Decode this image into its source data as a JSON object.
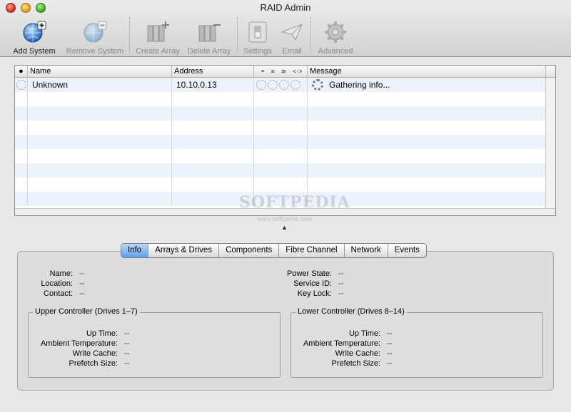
{
  "window": {
    "title": "RAID Admin"
  },
  "toolbar": {
    "items": [
      {
        "label": "Add System",
        "icon": "globe-plus-icon",
        "enabled": true
      },
      {
        "label": "Remove System",
        "icon": "globe-minus-icon",
        "enabled": false
      },
      {
        "label": "Create Array",
        "icon": "disks-plus-icon",
        "enabled": false
      },
      {
        "label": "Delete Array",
        "icon": "disks-minus-icon",
        "enabled": false
      },
      {
        "label": "Settings",
        "icon": "switch-icon",
        "enabled": false
      },
      {
        "label": "Email",
        "icon": "paper-plane-icon",
        "enabled": false
      },
      {
        "label": "Advanced",
        "icon": "gear-icon",
        "enabled": false
      }
    ]
  },
  "table": {
    "columns": {
      "name": "Name",
      "address": "Address",
      "message": "Message"
    },
    "status_icons": [
      "drive-icon",
      "stack-icon",
      "wave-icon",
      "link-arrows-icon"
    ],
    "status_symbols": [
      "◓",
      "≡",
      "≋",
      "<·>"
    ],
    "rows": [
      {
        "name": "Unknown",
        "address": "10.10.0.13",
        "message": "Gathering info..."
      }
    ]
  },
  "watermark": {
    "text": "SOFTPEDIA",
    "sub": "www.softpedia.com"
  },
  "tabs": [
    {
      "label": "Info",
      "active": true
    },
    {
      "label": "Arrays & Drives",
      "active": false
    },
    {
      "label": "Components",
      "active": false
    },
    {
      "label": "Fibre Channel",
      "active": false
    },
    {
      "label": "Network",
      "active": false
    },
    {
      "label": "Events",
      "active": false
    }
  ],
  "info": {
    "left": [
      {
        "label": "Name:",
        "value": "--"
      },
      {
        "label": "Location:",
        "value": "--"
      },
      {
        "label": "Contact:",
        "value": "--"
      }
    ],
    "right": [
      {
        "label": "Power State:",
        "value": "--"
      },
      {
        "label": "Service ID:",
        "value": "--"
      },
      {
        "label": "Key Lock:",
        "value": "--"
      }
    ]
  },
  "upper_controller": {
    "title": "Upper Controller (Drives 1–7)",
    "fields": [
      {
        "label": "Up Time:",
        "value": "--"
      },
      {
        "label": "Ambient Temperature:",
        "value": "--"
      },
      {
        "label": "Write Cache:",
        "value": "--"
      },
      {
        "label": "Prefetch Size:",
        "value": "--"
      }
    ]
  },
  "lower_controller": {
    "title": "Lower Controller (Drives 8–14)",
    "fields": [
      {
        "label": "Up Time:",
        "value": "--"
      },
      {
        "label": "Ambient Temperature:",
        "value": "--"
      },
      {
        "label": "Write Cache:",
        "value": "--"
      },
      {
        "label": "Prefetch Size:",
        "value": "--"
      }
    ]
  },
  "colors": {
    "tab_active": "#5f9ee6",
    "row_stripe": "#edf3fe"
  }
}
